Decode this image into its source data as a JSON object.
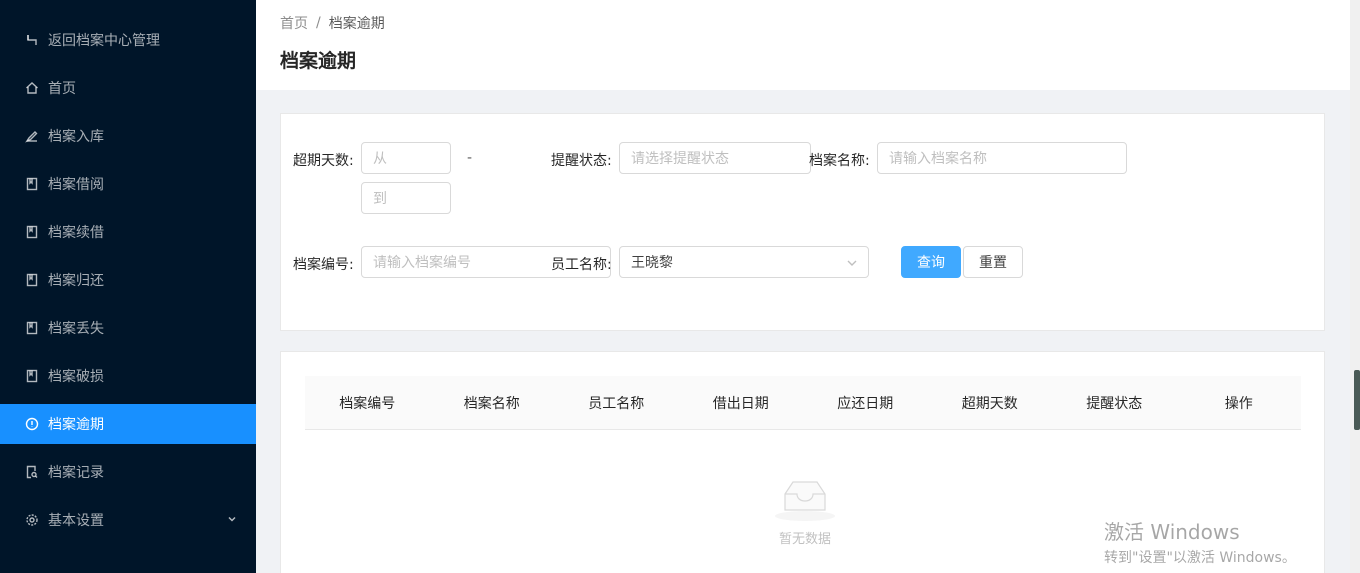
{
  "sidebar": {
    "items": [
      {
        "label": "返回档案中心管理",
        "icon": "back-icon"
      },
      {
        "label": "首页",
        "icon": "home-icon"
      },
      {
        "label": "档案入库",
        "icon": "edit-icon"
      },
      {
        "label": "档案借阅",
        "icon": "book-icon"
      },
      {
        "label": "档案续借",
        "icon": "book-icon"
      },
      {
        "label": "档案归还",
        "icon": "book-icon"
      },
      {
        "label": "档案丢失",
        "icon": "book-icon"
      },
      {
        "label": "档案破损",
        "icon": "book-icon"
      },
      {
        "label": "档案逾期",
        "icon": "alert-icon",
        "active": true
      },
      {
        "label": "档案记录",
        "icon": "file-search-icon"
      },
      {
        "label": "基本设置",
        "icon": "gear-icon"
      }
    ]
  },
  "header": {
    "breadcrumb": [
      "首页",
      "档案逾期"
    ],
    "breadcrumb_separator": "/",
    "title": "档案逾期"
  },
  "filter": {
    "overdue_days_label": "超期天数:",
    "from_placeholder": "从",
    "to_placeholder": "到",
    "range_dash": "-",
    "remind_status_label": "提醒状态:",
    "remind_status_placeholder": "请选择提醒状态",
    "archive_name_label": "档案名称:",
    "archive_name_placeholder": "请输入档案名称",
    "archive_no_label": "档案编号:",
    "archive_no_placeholder": "请输入档案编号",
    "employee_label": "员工名称:",
    "employee_value": "王晓黎",
    "query_button": "查询",
    "reset_button": "重置"
  },
  "table": {
    "columns": [
      "档案编号",
      "档案名称",
      "员工名称",
      "借出日期",
      "应还日期",
      "超期天数",
      "提醒状态",
      "操作"
    ],
    "rows": [],
    "empty_text": "暂无数据"
  },
  "watermark": {
    "line1": "激活 Windows",
    "line2": "转到\"设置\"以激活 Windows。"
  },
  "colors": {
    "sidebar_bg": "#001529",
    "active_item": "#1890ff",
    "primary": "#40a9ff"
  }
}
